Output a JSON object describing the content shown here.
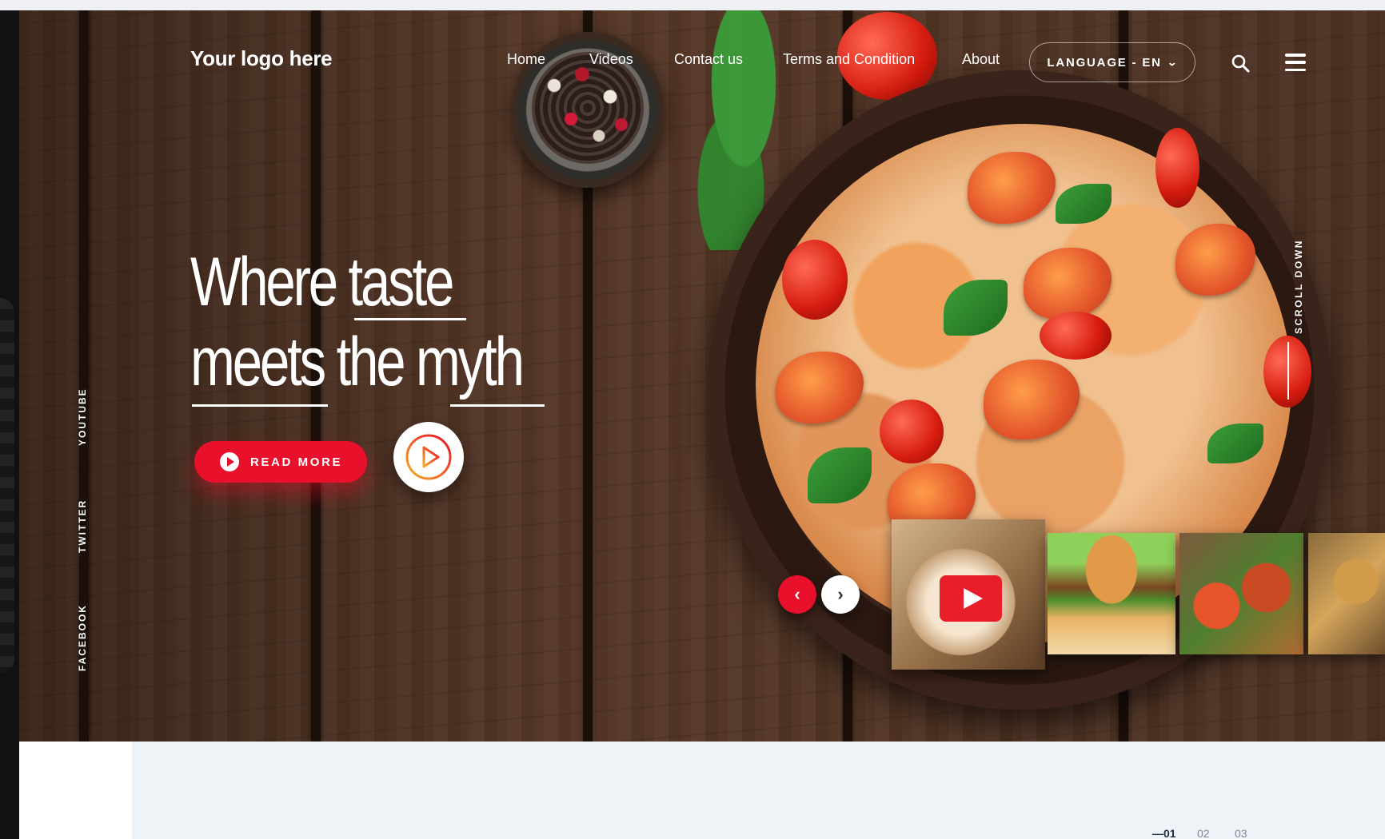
{
  "brand": {
    "logo_text": "Your logo here"
  },
  "nav": {
    "items": [
      {
        "label": "Home"
      },
      {
        "label": "Videos"
      },
      {
        "label": "Contact us"
      },
      {
        "label": "Terms and Condition"
      },
      {
        "label": "About"
      }
    ],
    "language_label": "LANGUAGE - EN"
  },
  "hero": {
    "headline_line1": "Where taste",
    "headline_line2": "meets the myth",
    "read_more_label": "READ MORE"
  },
  "social": {
    "youtube": "YOUTUBE",
    "twitter": "TWITTER",
    "facebook": "FACEBOOK"
  },
  "scroll_label": "SCROLL DOWN",
  "carousel": {
    "prev_glyph": "‹",
    "next_glyph": "›",
    "thumbnails": [
      "burrito-video",
      "burger",
      "salad-bowl",
      "platter"
    ]
  },
  "pagination": {
    "items": [
      "—01",
      "02",
      "03"
    ],
    "active_index": 0
  },
  "colors": {
    "accent": "#e8102b",
    "text_on_dark": "#ffffff",
    "bottom_panel": "#eef3f8"
  }
}
